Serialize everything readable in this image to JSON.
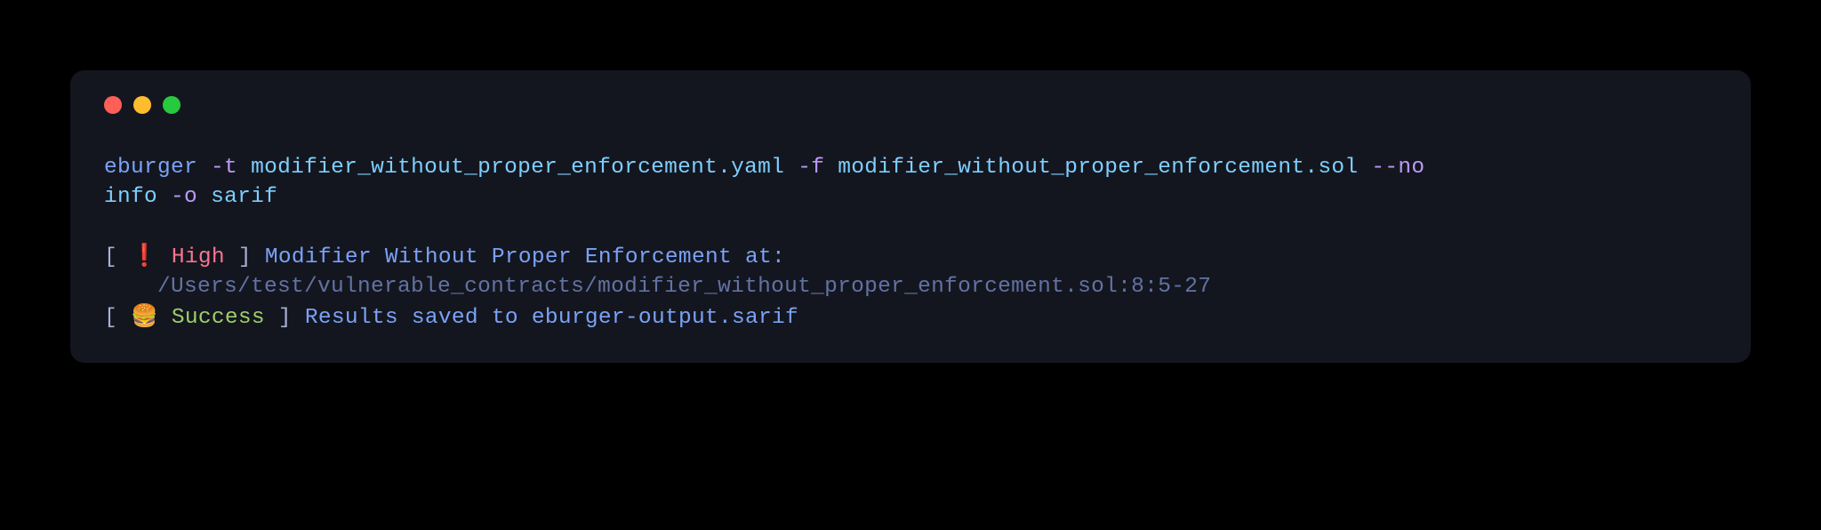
{
  "command": {
    "program": "eburger",
    "flag_t": "-t",
    "arg_t": "modifier_without_proper_enforcement.yaml",
    "flag_f": "-f",
    "arg_f": "modifier_without_proper_enforcement.sol",
    "flag_no": "--no",
    "arg_no": "info",
    "flag_o": "-o",
    "arg_o": "sarif"
  },
  "finding": {
    "bracket_open": "[ ",
    "exclaim": "❗",
    "severity": " High",
    "bracket_close": " ]",
    "title": " Modifier Without Proper Enforcement at:",
    "path": "    /Users/test/vulnerable_contracts/modifier_without_proper_enforcement.sol:8:5-27"
  },
  "success": {
    "bracket_open": "[ ",
    "emoji": "🍔",
    "label": " Success",
    "bracket_close": " ]",
    "message": " Results saved to eburger-output.sarif"
  }
}
